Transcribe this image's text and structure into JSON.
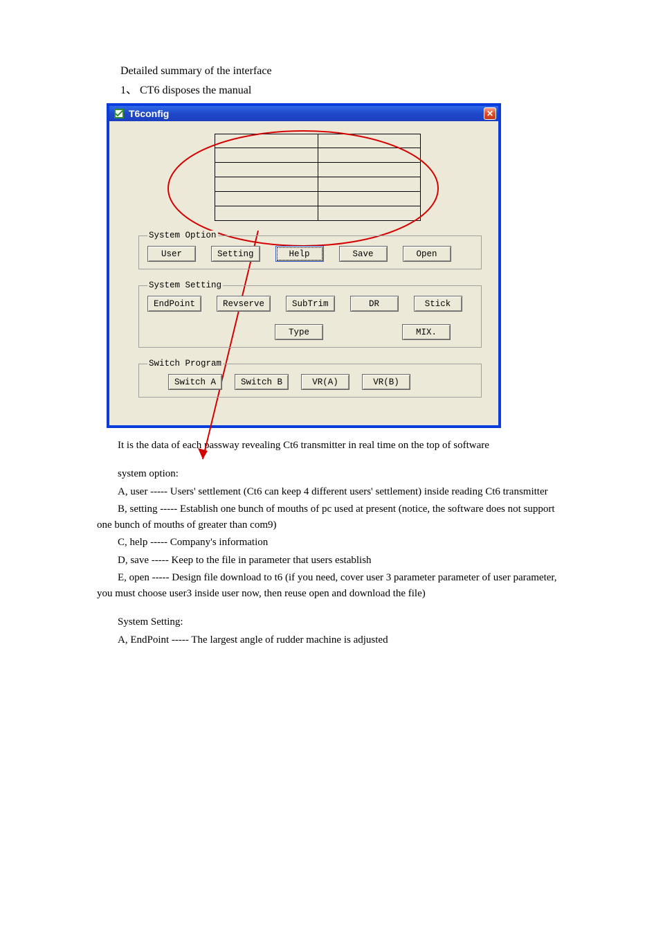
{
  "summary": {
    "line1": "Detailed summary of the interface",
    "line2": "1、 CT6 disposes the manual"
  },
  "window": {
    "title": "T6config",
    "close_glyph": "✕"
  },
  "system_option": {
    "legend": "System Option",
    "user": "User",
    "setting": "Setting",
    "help": "Help",
    "save": "Save",
    "open": "Open"
  },
  "system_setting": {
    "legend": "System Setting",
    "endpoint": "EndPoint",
    "revserve": "Revserve",
    "subtrim": "SubTrim",
    "dr": "DR",
    "stick": "Stick",
    "type": "Type",
    "mix": "MIX."
  },
  "switch_program": {
    "legend": "Switch Program",
    "switch_a": "Switch A",
    "switch_b": "Switch B",
    "vr_a": "VR(A)",
    "vr_b": "VR(B)"
  },
  "doc": {
    "data_caption": "It is the data of each passway revealing Ct6 transmitter in real time on the top of software",
    "sys_opt_header": "system option:",
    "a_user": "A, user ----- Users' settlement (Ct6 can keep 4 different users' settlement) inside reading Ct6 transmitter",
    "b_setting": "B, setting ----- Establish one bunch of mouths of pc used at present (notice, the software does not support one bunch of mouths of greater than com9)",
    "c_help": "C, help ----- Company's information",
    "d_save": "D, save ----- Keep to the file in parameter that users establish",
    "e_open": "E, open ----- Design file download to t6 (if you need, cover user 3 parameter parameter of user parameter, you must choose user3 inside user now, then reuse open and download the file)",
    "ss_header": "System Setting:",
    "a_endpoint": "A, EndPoint ----- The largest angle of rudder machine is adjusted"
  }
}
